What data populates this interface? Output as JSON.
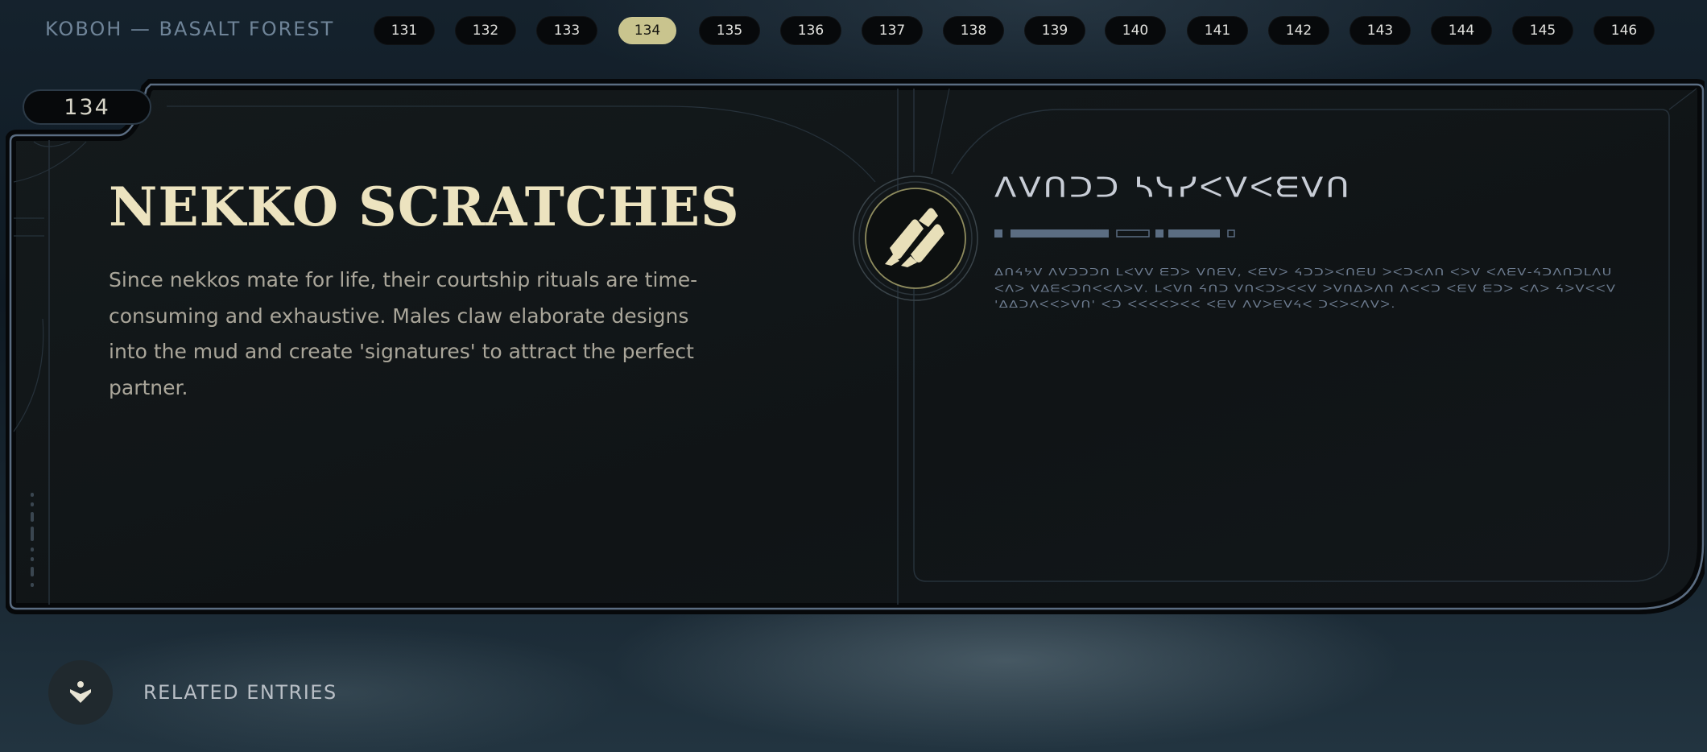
{
  "header": {
    "region_title": "KOBOH — BASALT FOREST",
    "pages": [
      "131",
      "132",
      "133",
      "134",
      "135",
      "136",
      "137",
      "138",
      "139",
      "140",
      "141",
      "142",
      "143",
      "144",
      "145",
      "146"
    ],
    "active_page": "134"
  },
  "entry": {
    "number": "134",
    "title": "NEKKO SCRATCHES",
    "description": "Since nekkos mate for life, their courtship rituals are time-consuming and exhaustive. Males claw elaborate designs into the mud and create 'signatures' to attract the perfect partner.",
    "aurebesh_title": "ᐱᐯᑎᑐᑐ ᓴᓭᓯᐸᐯᐸᗴᐯᑎ",
    "aurebesh_body": "ᐃᑎᔦᔭᐯ ᐱᐯᑐᑐᑐᑎ ᒪᐸᐯᐯ ᗴᑐᐳ ᐯᑎᗴᐯ, ᐸᗴᐯᐳ ᔦᑐᑐᐳᐸᑎᗴᑌ ᐳᐸᑐᐸᐱᑎ ᐸᐳᐯ ᐸᐱᗴᐯ-ᔦᑐᐱᑎᑐᒪᐱᑌ ᐸᐱᐳ ᐯᐃᗴᐸᑐᑎᐸᐸᐱᐳᐯ. ᒪᐸᐯᑎ ᔦᑎᑐ ᐯᑎᐸᑐᐳᐸᐸᐯ ᐳᐯᑎᐃᐳᐱᑎ ᐱᐸᐸᑐ ᐸᗴᐯ ᗴᑐᐳ ᐸᐱᐳ ᔦᐳᐯᐸᐸᐯ 'ᐃᐃᑐᐱᐸᐸᐳᐯᑎ' ᐸᑐ ᐸᐸᐸᐸᐳᐸᐸ ᐸᗴᐯ ᐱᐯᐳᗴᐯᔦᐸ ᑐᐸᐳᐸᐱᐯᐳ."
  },
  "related": {
    "label": "RELATED ENTRIES",
    "icon": "person-down-arrow-icon"
  },
  "colors": {
    "accent": "#c9c48e",
    "title": "#ece3bf",
    "frame": "#5a6b80",
    "panel": "#131719"
  }
}
